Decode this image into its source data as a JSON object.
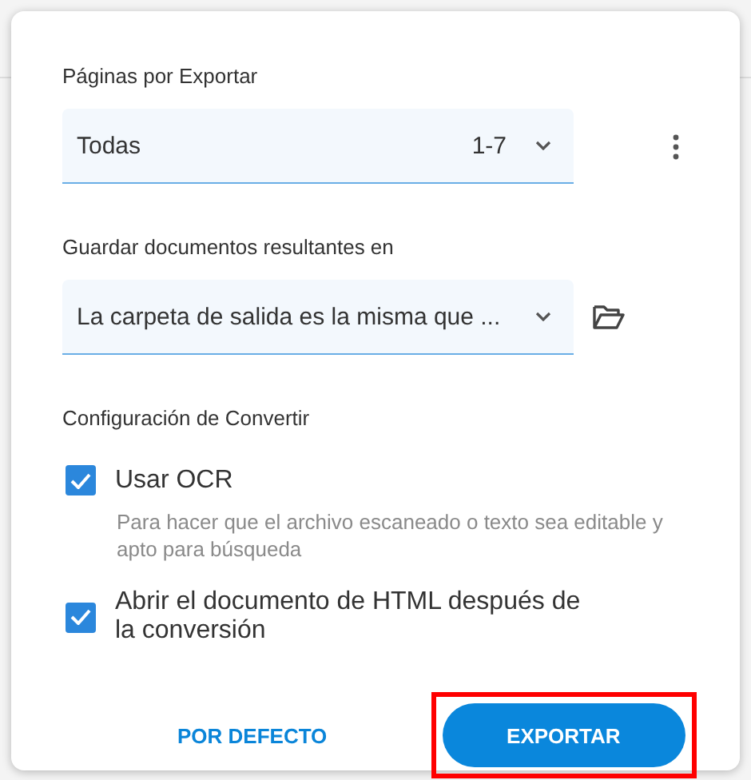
{
  "pages_section": {
    "title": "Páginas por Exportar",
    "select": {
      "value": "Todas",
      "range": "1-7"
    }
  },
  "output_section": {
    "title": "Guardar documentos resultantes en",
    "select": {
      "value": "La carpeta de salida es la misma que ..."
    }
  },
  "convert_section": {
    "title": "Configuración de Convertir",
    "options": [
      {
        "label": "Usar OCR",
        "checked": true,
        "description": "Para hacer que el archivo escaneado o texto sea editable y apto para búsqueda"
      },
      {
        "label": "Abrir el documento de HTML después de la conversión",
        "checked": true
      }
    ]
  },
  "buttons": [
    {
      "label": "POR DEFECTO",
      "kind": "text"
    },
    {
      "label": "EXPORTAR",
      "kind": "primary",
      "highlighted": true
    }
  ]
}
